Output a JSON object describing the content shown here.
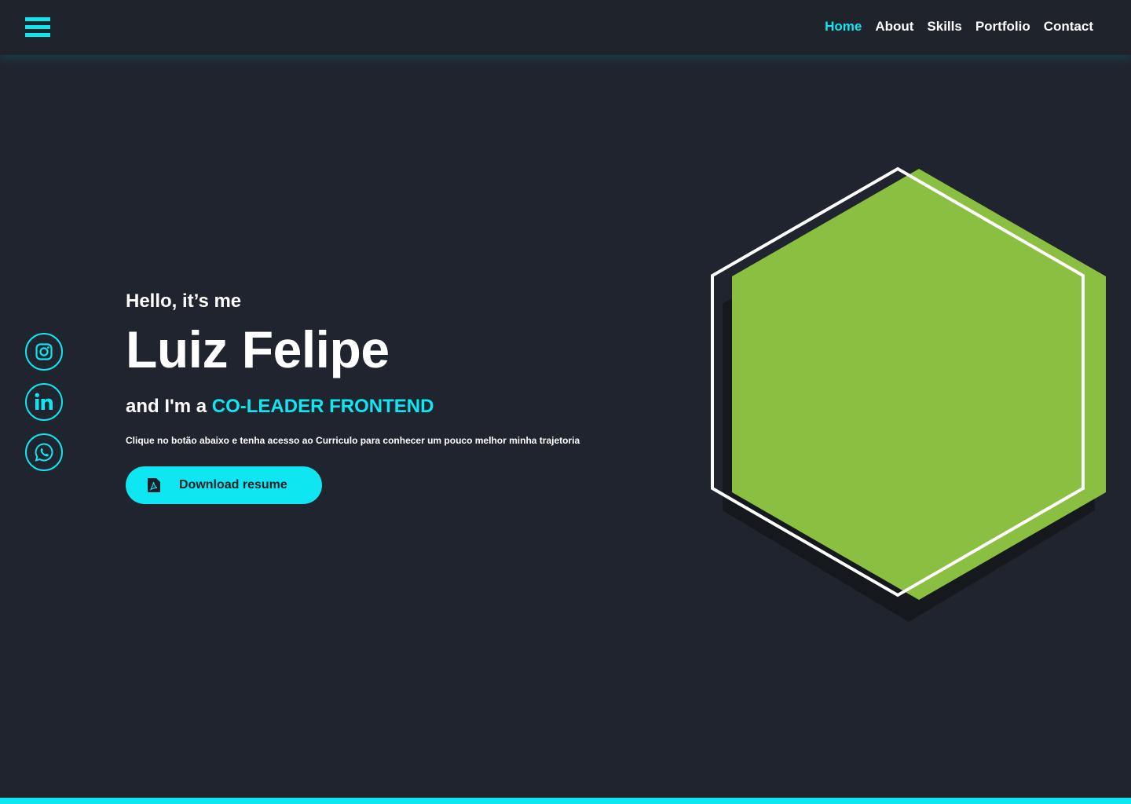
{
  "nav": {
    "items": [
      {
        "label": "Home",
        "active": true
      },
      {
        "label": "About",
        "active": false
      },
      {
        "label": "Skills",
        "active": false
      },
      {
        "label": "Portfolio",
        "active": false
      },
      {
        "label": "Contact",
        "active": false
      }
    ]
  },
  "hero": {
    "greeting": "Hello, it’s me",
    "name": "Luiz Felipe",
    "role_prefix": "and I'm a",
    "role_highlight": "CO-LEADER FRONTEND",
    "description": "Clique no botão abaixo e tenha acesso ao Curriculo para conhecer um pouco melhor minha trajetoria",
    "download_label": "Download resume"
  },
  "social": [
    {
      "icon": "instagram-icon"
    },
    {
      "icon": "linkedin-icon"
    },
    {
      "icon": "whatsapp-icon"
    }
  ],
  "colors": {
    "accent": "#0ee6f2",
    "background": "#20242e",
    "hexagon": "#8bbf41"
  }
}
